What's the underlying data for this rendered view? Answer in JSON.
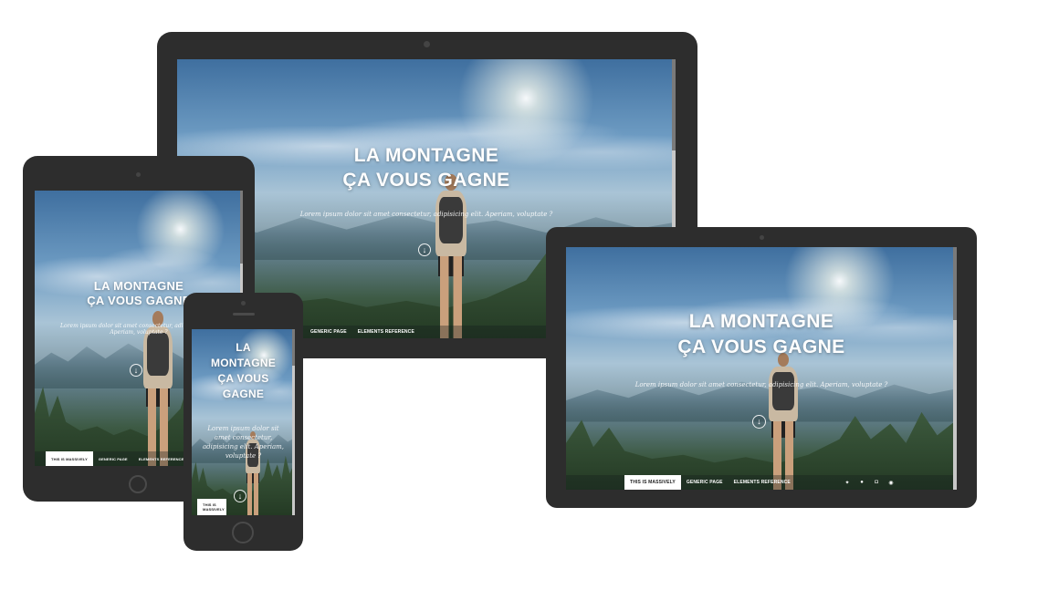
{
  "hero": {
    "title_line1": "LA MONTAGNE",
    "title_line2": "ÇA VOUS GAGNE",
    "phone_title_lines": [
      "LA",
      "MONTAGNE",
      "ÇA VOUS",
      "GAGNE"
    ],
    "subtitle": "Lorem ipsum dolor sit amet consectetur, adipisicing elit. Aperiam, voluptate ?",
    "scroll_icon": "arrow-down-circle-icon"
  },
  "nav": {
    "items": [
      "THIS IS MASSIVELY",
      "GENERIC PAGE",
      "ELEMENTS REFERENCE"
    ],
    "phone_item": "THIS IS MASSIVELY"
  },
  "social_icons": [
    "twitter-icon",
    "facebook-icon",
    "instagram-icon",
    "github-icon"
  ],
  "colors": {
    "device_frame": "#2d2d2d",
    "nav_active_bg": "#ffffff",
    "text": "#ffffff"
  }
}
